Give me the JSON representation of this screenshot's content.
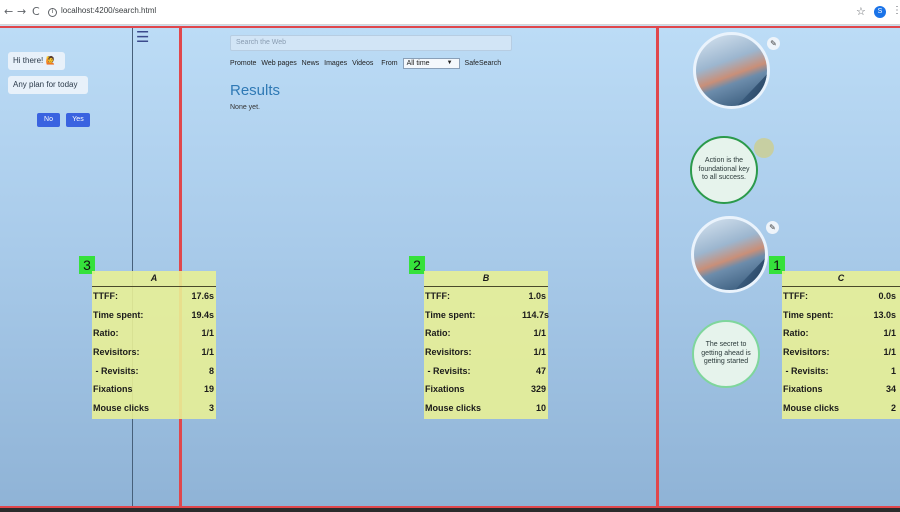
{
  "browser": {
    "back": "←",
    "forward": "→",
    "reload": "C",
    "url": "localhost:4200/search.html",
    "star": "☆",
    "profile_initial": "S",
    "menu": "⋮"
  },
  "sidebar": {
    "menu_icon": "☰",
    "chat": {
      "greeting": "Hi there! 🙋",
      "question": "Any plan for today",
      "no_label": "No",
      "yes_label": "Yes"
    }
  },
  "search": {
    "placeholder": "Search the Web",
    "filters": [
      "Promote",
      "Web pages",
      "News",
      "Images",
      "Videos"
    ],
    "from_label": "From",
    "time_selected": "All time",
    "safesearch_label": "SafeSearch",
    "results_title": "Results",
    "results_empty": "None yet."
  },
  "right_panel": {
    "quote1": "Action is the foundational key to all success.",
    "quote2": "The secret to getting ahead is getting started"
  },
  "stats": [
    {
      "marker": "3",
      "title": "A",
      "rows": [
        {
          "label": "TTFF:",
          "value": "17.6s"
        },
        {
          "label": "Time spent:",
          "value": "19.4s"
        },
        {
          "label": "Ratio:",
          "value": "1/1"
        },
        {
          "label": "Revisitors:",
          "value": "1/1"
        },
        {
          "label": " - Revisits:",
          "value": "8"
        },
        {
          "label": "Fixations",
          "value": "19"
        },
        {
          "label": "Mouse clicks",
          "value": "3"
        }
      ]
    },
    {
      "marker": "2",
      "title": "B",
      "rows": [
        {
          "label": "TTFF:",
          "value": "1.0s"
        },
        {
          "label": "Time spent:",
          "value": "114.7s"
        },
        {
          "label": "Ratio:",
          "value": "1/1"
        },
        {
          "label": "Revisitors:",
          "value": "1/1"
        },
        {
          "label": " - Revisits:",
          "value": "47"
        },
        {
          "label": "Fixations",
          "value": "329"
        },
        {
          "label": "Mouse clicks",
          "value": "10"
        }
      ]
    },
    {
      "marker": "1",
      "title": "C",
      "rows": [
        {
          "label": "TTFF:",
          "value": "0.0s"
        },
        {
          "label": "Time spent:",
          "value": "13.0s"
        },
        {
          "label": "Ratio:",
          "value": "1/1"
        },
        {
          "label": "Revisitors:",
          "value": "1/1"
        },
        {
          "label": " - Revisits:",
          "value": "1"
        },
        {
          "label": "Fixations",
          "value": "34"
        },
        {
          "label": "Mouse clicks",
          "value": "2"
        }
      ]
    }
  ],
  "colors": {
    "region_frame": "#e0474c",
    "stat_box": "#e8f096",
    "marker": "#35e13b",
    "chat_button": "#3a63e0",
    "results_title": "#2f79b5"
  }
}
